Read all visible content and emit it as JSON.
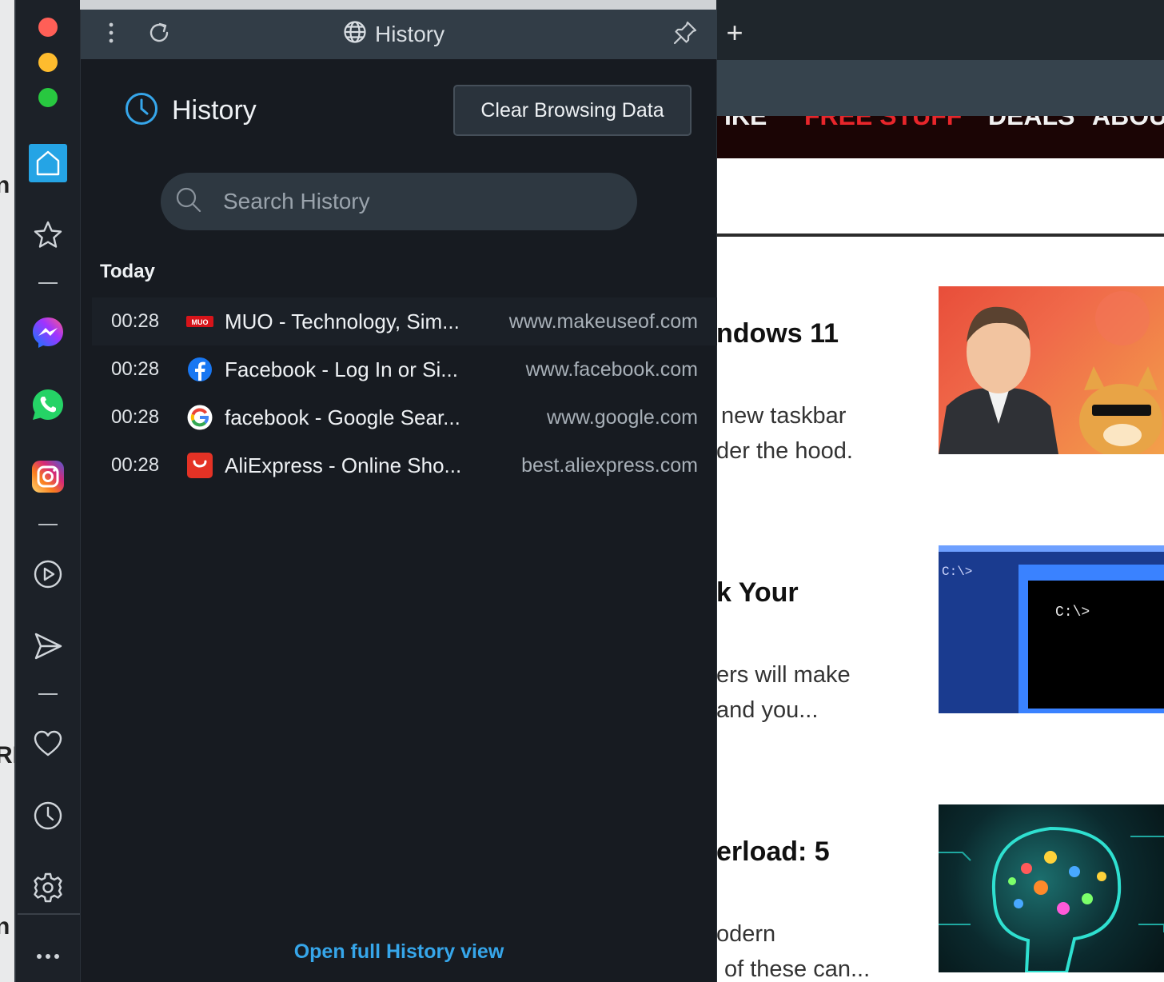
{
  "panel": {
    "header_title": "History",
    "heading": "History",
    "clear_button": "Clear Browsing Data",
    "search_placeholder": "Search History",
    "section_today": "Today",
    "open_full": "Open full History view",
    "accent_color": "#36a6ea"
  },
  "history": [
    {
      "time": "00:28",
      "title": "MUO - Technology, Sim...",
      "domain": "www.makeuseof.com",
      "icon": "muo-favicon"
    },
    {
      "time": "00:28",
      "title": "Facebook - Log In or Si...",
      "domain": "www.facebook.com",
      "icon": "facebook-favicon"
    },
    {
      "time": "00:28",
      "title": "facebook - Google Sear...",
      "domain": "www.google.com",
      "icon": "google-favicon"
    },
    {
      "time": "00:28",
      "title": "AliExpress - Online Sho...",
      "domain": "best.aliexpress.com",
      "icon": "aliexpress-favicon"
    }
  ],
  "sidebar": {
    "items": [
      "home-icon",
      "bookmark-icon",
      "messenger-icon",
      "whatsapp-icon",
      "instagram-icon",
      "player-icon",
      "send-icon",
      "heart-icon",
      "history-icon",
      "settings-icon",
      "more-icon"
    ]
  },
  "background_page": {
    "new_tab": "+",
    "headline_1": "ndows 11",
    "text_1a": "new taskbar",
    "text_1b": "der the hood.",
    "headline_2": "k Your",
    "text_2a": "ers will make",
    "text_2b": "and you...",
    "headline_3": "erload: 5",
    "text_3a": "odern",
    "text_3b": "of these can...",
    "thumb_prompt_1": "C:\\>",
    "thumb_prompt_2": "C:\\>"
  }
}
